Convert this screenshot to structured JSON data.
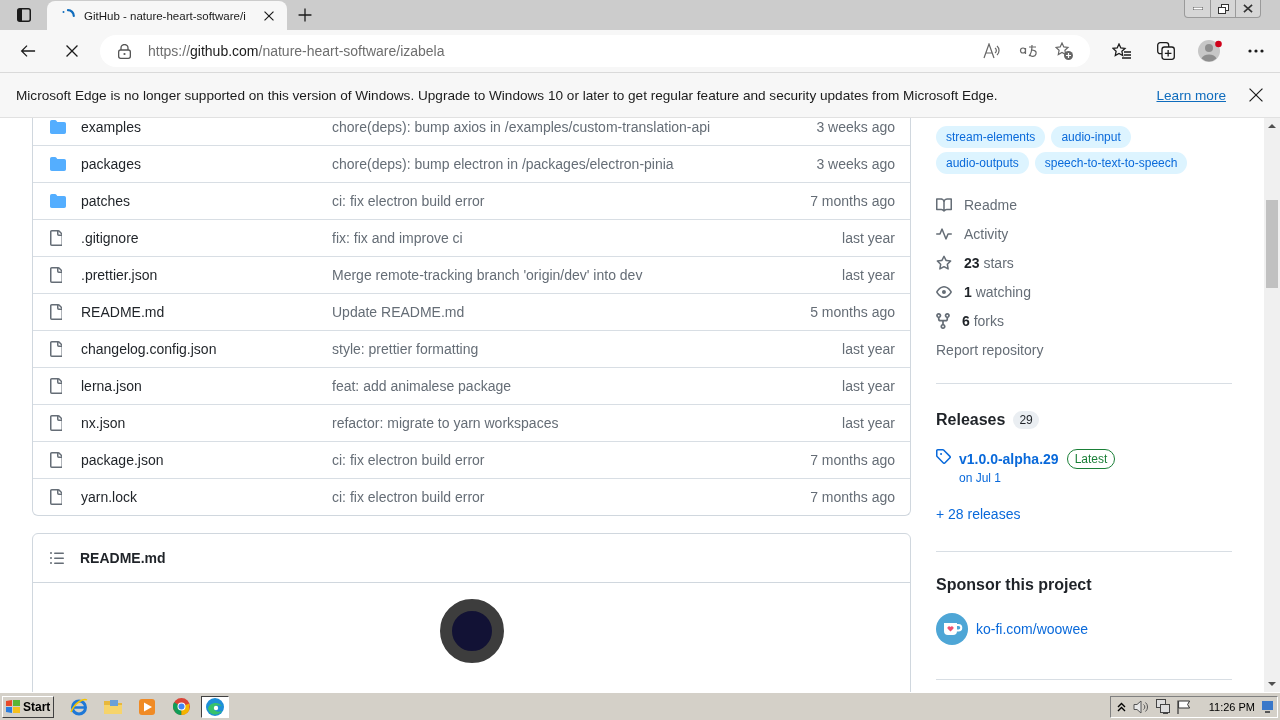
{
  "browser": {
    "tab": {
      "title": "GitHub - nature-heart-software/i",
      "loading": true
    },
    "url": {
      "scheme": "https://",
      "host": "github.com",
      "path": "/nature-heart-software/izabela"
    },
    "profile": {
      "notification": true
    }
  },
  "infobar": {
    "message": "Microsoft Edge is no longer supported on this version of Windows. Upgrade to Windows 10 or later to get regular feature and security updates from Microsoft Edge.",
    "link": "Learn more"
  },
  "files": [
    {
      "kind": "folder",
      "name": "examples",
      "message": "chore(deps): bump axios in /examples/custom-translation-api",
      "date": "3 weeks ago"
    },
    {
      "kind": "folder",
      "name": "packages",
      "message": "chore(deps): bump electron in /packages/electron-pinia",
      "date": "3 weeks ago"
    },
    {
      "kind": "folder",
      "name": "patches",
      "message": "ci: fix electron build error",
      "date": "7 months ago"
    },
    {
      "kind": "file",
      "name": ".gitignore",
      "message": "fix: fix and improve ci",
      "date": "last year"
    },
    {
      "kind": "file",
      "name": ".prettier.json",
      "message": "Merge remote-tracking branch 'origin/dev' into dev",
      "date": "last year"
    },
    {
      "kind": "file",
      "name": "README.md",
      "message": "Update README.md",
      "date": "5 months ago"
    },
    {
      "kind": "file",
      "name": "changelog.config.json",
      "message": "style: prettier formatting",
      "date": "last year"
    },
    {
      "kind": "file",
      "name": "lerna.json",
      "message": "feat: add animalese package",
      "date": "last year"
    },
    {
      "kind": "file",
      "name": "nx.json",
      "message": "refactor: migrate to yarn workspaces",
      "date": "last year"
    },
    {
      "kind": "file",
      "name": "package.json",
      "message": "ci: fix electron build error",
      "date": "7 months ago"
    },
    {
      "kind": "file",
      "name": "yarn.lock",
      "message": "ci: fix electron build error",
      "date": "7 months ago"
    }
  ],
  "readme": {
    "title": "README.md"
  },
  "sidebar": {
    "topics": [
      "stream-elements",
      "audio-input",
      "audio-outputs",
      "speech-to-text-to-speech"
    ],
    "links": [
      {
        "kind": "readme",
        "label": "Readme"
      },
      {
        "kind": "activity",
        "label": "Activity"
      },
      {
        "kind": "stars",
        "label": "**23** stars"
      },
      {
        "kind": "watching",
        "label": "**1** watching"
      },
      {
        "kind": "forks",
        "label": "**6** forks"
      }
    ],
    "report": "Report repository",
    "releases": {
      "title": "Releases",
      "count": "29",
      "latest": {
        "name": "v1.0.0-alpha.29",
        "badge": "Latest",
        "date": "on Jul 1"
      },
      "more": "+ 28 releases"
    },
    "sponsor": {
      "title": "Sponsor this project",
      "links": [
        {
          "label": "ko-fi.com/woowee"
        }
      ]
    }
  },
  "taskbar": {
    "start": "Start",
    "apps": [
      {
        "kind": "ie",
        "selected": false
      },
      {
        "kind": "explorer",
        "selected": false
      },
      {
        "kind": "media",
        "selected": false
      },
      {
        "kind": "chrome",
        "selected": false
      },
      {
        "kind": "edge",
        "selected": true
      }
    ],
    "clock": "11:26 PM"
  }
}
